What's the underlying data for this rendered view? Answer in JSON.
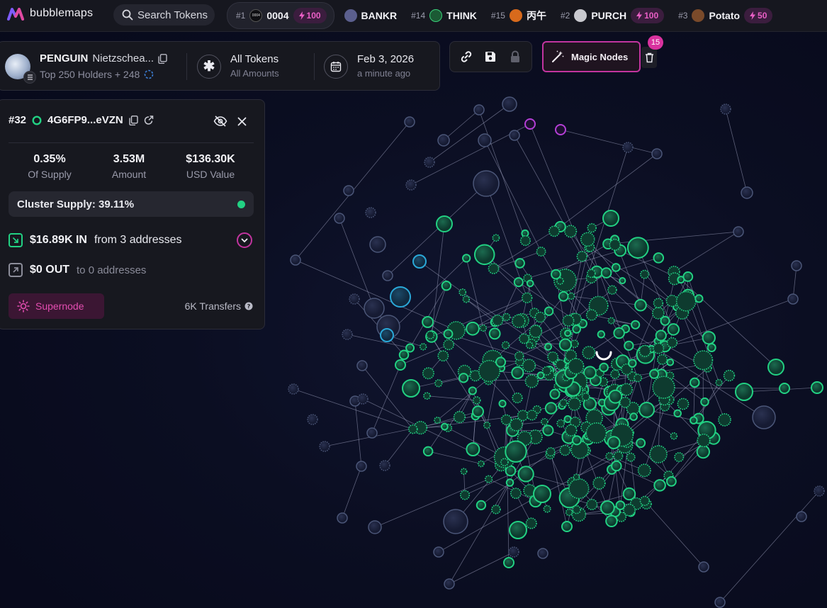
{
  "brand": {
    "name": "bubblemaps"
  },
  "search": {
    "label": "Search Tokens"
  },
  "ticker": [
    {
      "rank": "#1",
      "name": "0004",
      "avatar_text": "0004",
      "boost": "100",
      "avatar_color": "#0f0f12"
    },
    {
      "rank": "",
      "name": "BANKR",
      "avatar_color": "#5b5f8e"
    },
    {
      "rank": "#14",
      "name": "THINK",
      "avatar_color": "#1b5a34"
    },
    {
      "rank": "#15",
      "name": "丙午",
      "avatar_color": "#d86a1c"
    },
    {
      "rank": "#2",
      "name": "PURCH",
      "boost": "100",
      "avatar_color": "#c9c9cf"
    },
    {
      "rank": "#3",
      "name": "Potato",
      "boost": "50",
      "avatar_color": "#7a4a2a"
    }
  ],
  "token": {
    "symbol": "PENGUIN",
    "name": "Nietzschea...",
    "holders": "Top 250 Holders + 248"
  },
  "filter": {
    "title": "All Tokens",
    "subtitle": "All Amounts"
  },
  "date": {
    "title": "Feb 3, 2026",
    "subtitle": "a minute ago"
  },
  "magic": {
    "label": "Magic Nodes",
    "count": "15"
  },
  "address": {
    "rank": "#32",
    "short": "4G6FP9...eVZN",
    "stats": [
      {
        "value": "0.35%",
        "label": "Of Supply"
      },
      {
        "value": "3.53M",
        "label": "Amount"
      },
      {
        "value": "$136.30K",
        "label": "USD Value"
      }
    ],
    "cluster_supply": "Cluster Supply: 39.11%",
    "in": {
      "amount": "$16.89K IN",
      "rest": "from 3 addresses"
    },
    "out": {
      "amount": "$0 OUT",
      "rest": "to 0 addresses"
    },
    "supernode_label": "Supernode",
    "transfers": "6K Transfers"
  },
  "colors": {
    "accent": "#c2349f",
    "green_node": "#22d183",
    "blue_node": "#2aa8d8",
    "muted_node": "#4b5678",
    "purple_node": "#b43fd6"
  }
}
